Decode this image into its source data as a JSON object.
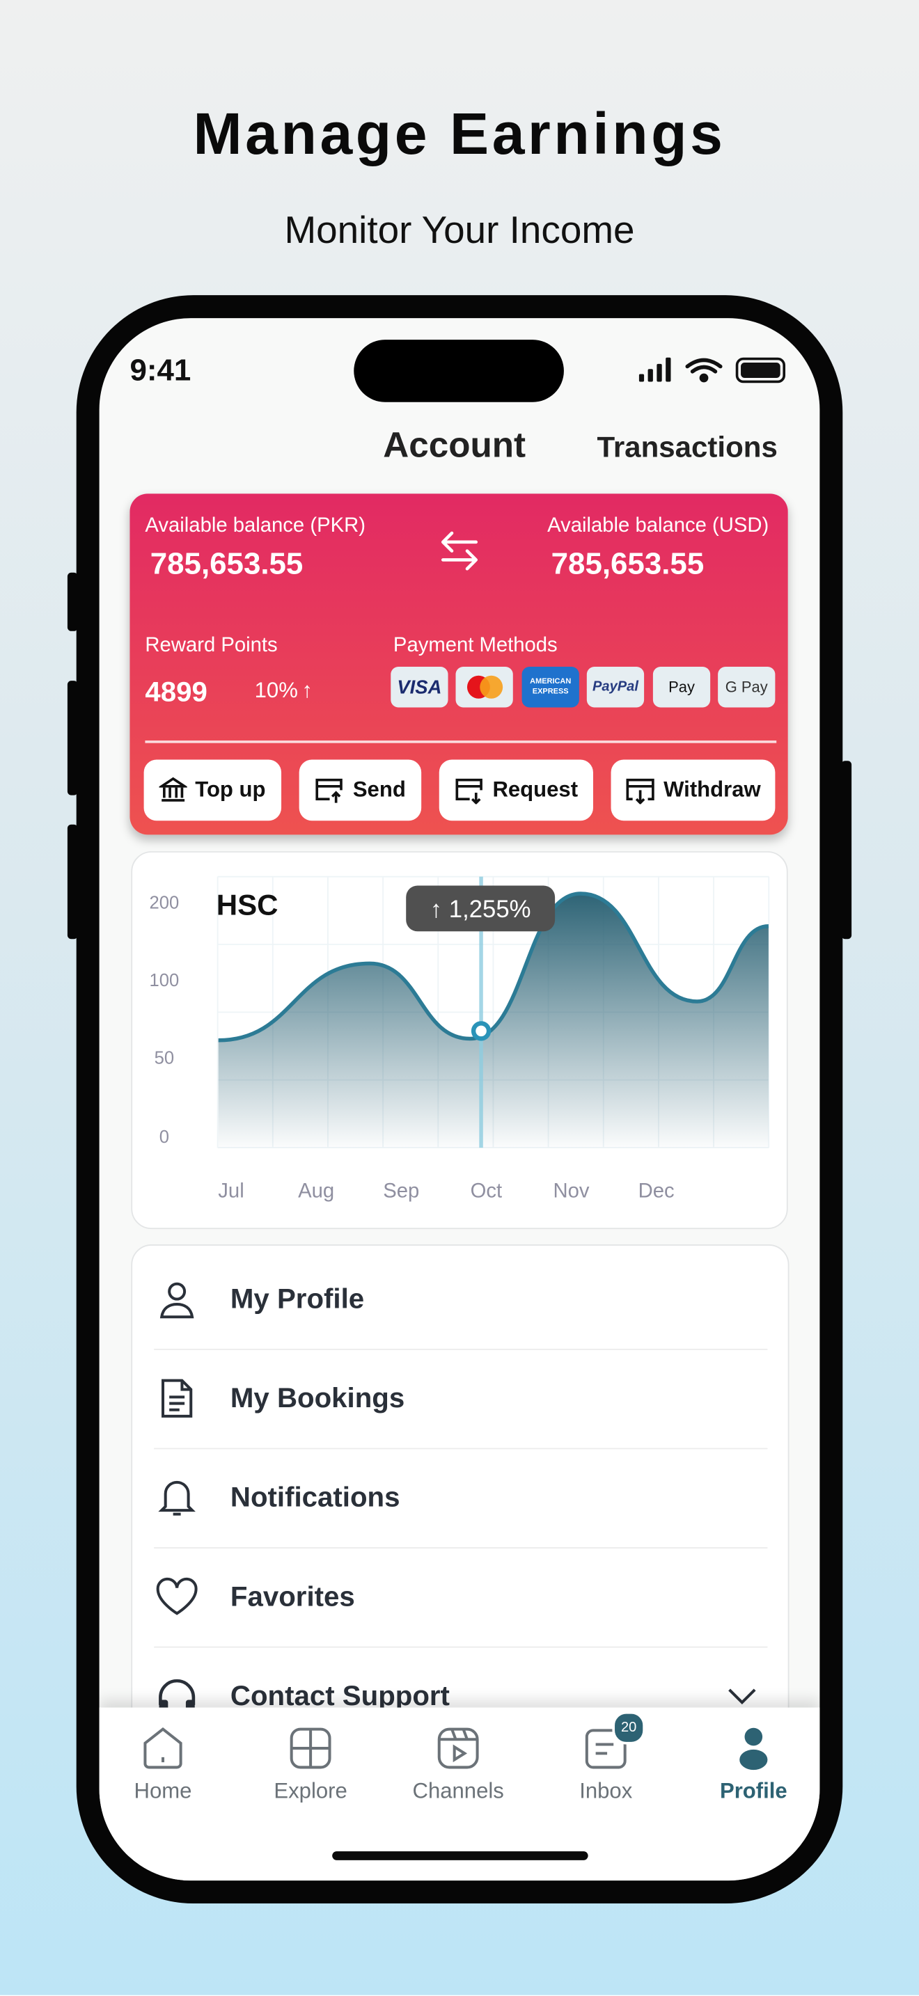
{
  "hero": {
    "title": "Manage Earnings",
    "subtitle": "Monitor Your Income"
  },
  "status_bar": {
    "time": "9:41"
  },
  "header": {
    "tabs": [
      {
        "label": "Account",
        "active": true
      },
      {
        "label": "Transactions",
        "active": false
      }
    ]
  },
  "balance_card": {
    "pkr_label": "Available balance (PKR)",
    "pkr_value": "785,653.55",
    "usd_label": "Available balance (USD)",
    "usd_value": "785,653.55",
    "swap_icon": "swap-arrows-icon",
    "reward_label": "Reward Points",
    "reward_value": "4899",
    "reward_change": "10%",
    "payment_label": "Payment Methods",
    "payment_methods": [
      "VISA",
      "Mastercard",
      "AMERICAN EXPRESS",
      "PayPal",
      "Apple Pay",
      "G Pay"
    ],
    "actions": [
      {
        "label": "Top up",
        "icon": "bank-icon"
      },
      {
        "label": "Send",
        "icon": "card-send-icon"
      },
      {
        "label": "Request",
        "icon": "card-request-icon"
      },
      {
        "label": "Withdraw",
        "icon": "withdraw-icon"
      }
    ],
    "colors": {
      "top": "#e22a63",
      "bottom": "#ee5250"
    }
  },
  "chart_data": {
    "type": "area",
    "title": "HSC",
    "categories": [
      "Jul",
      "Aug",
      "Sep",
      "Oct",
      "Nov",
      "Dec"
    ],
    "y_ticks": [
      0,
      50,
      100,
      200
    ],
    "points": [
      [
        -0.15,
        61
      ],
      [
        1.63,
        121
      ],
      [
        2.81,
        62
      ],
      [
        4.11,
        211
      ],
      [
        5.48,
        86
      ],
      [
        6.32,
        169
      ]
    ],
    "highlight": {
      "x": 2.94,
      "y": 67,
      "tooltip": "↑ 1,255%"
    },
    "grid": true,
    "colors": {
      "line": "#2c7b95",
      "fill": "#2e6476",
      "cursor": "#8ecde0",
      "tooltip": "#505050"
    }
  },
  "menu": {
    "items": [
      {
        "label": "My Profile",
        "icon": "user-icon"
      },
      {
        "label": "My Bookings",
        "icon": "document-icon"
      },
      {
        "label": "Notifications",
        "icon": "bell-icon"
      },
      {
        "label": "Favorites",
        "icon": "heart-icon"
      },
      {
        "label": "Contact Support",
        "icon": "headset-icon"
      }
    ]
  },
  "tabbar": {
    "items": [
      {
        "label": "Home",
        "icon": "home-icon"
      },
      {
        "label": "Explore",
        "icon": "grid-icon"
      },
      {
        "label": "Channels",
        "icon": "video-icon"
      },
      {
        "label": "Inbox",
        "icon": "inbox-icon",
        "badge": "20"
      },
      {
        "label": "Profile",
        "icon": "profile-icon",
        "active": true
      }
    ],
    "active_color": "#2d6273"
  }
}
